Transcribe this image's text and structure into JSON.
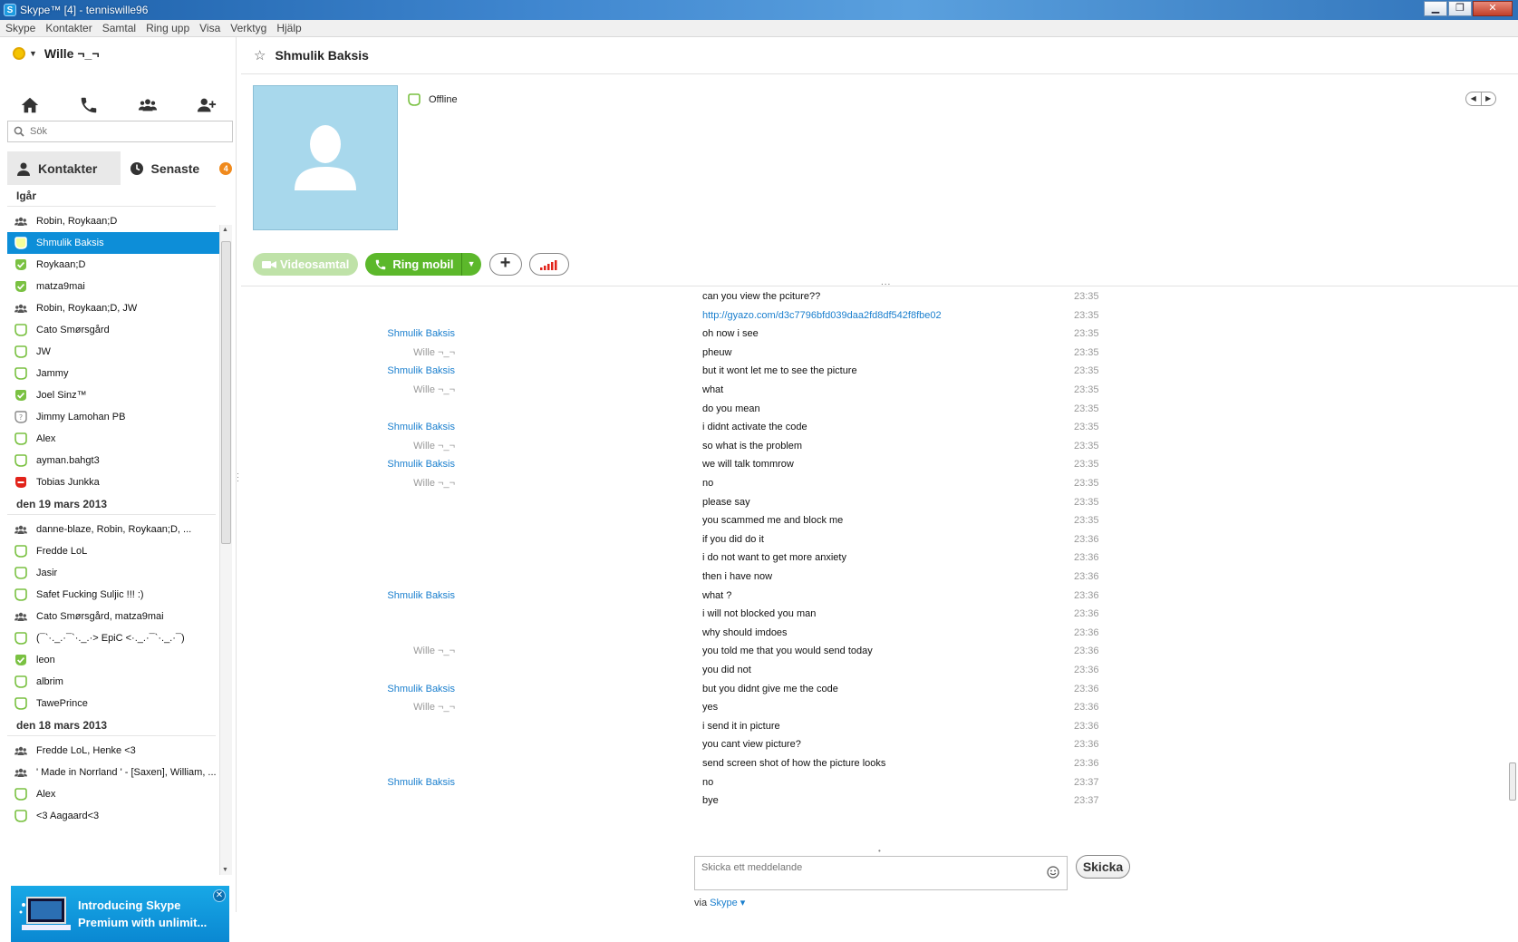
{
  "window": {
    "title": "Skype™ [4] - tenniswille96",
    "app_icon": "S",
    "minimize": "▁",
    "maximize": "❐",
    "close": "✕"
  },
  "menu": [
    "Skype",
    "Kontakter",
    "Samtal",
    "Ring upp",
    "Visa",
    "Verktyg",
    "Hjälp"
  ],
  "profile": {
    "name": "Wille ¬_¬",
    "status_color": "#f5c400"
  },
  "search": {
    "placeholder": "Sök"
  },
  "tabs": {
    "contacts": "Kontakter",
    "recent": "Senaste",
    "recent_badge": "4"
  },
  "contact_groups": [
    {
      "header": "Igår",
      "items": [
        {
          "name": "Robin, Roykaan;D",
          "icon": "group"
        },
        {
          "name": "Shmulik Baksis",
          "icon": "offline",
          "selected": true
        },
        {
          "name": "Roykaan;D",
          "icon": "online"
        },
        {
          "name": "matza9mai",
          "icon": "online"
        },
        {
          "name": "Robin, Roykaan;D, JW",
          "icon": "group"
        },
        {
          "name": "Cato Smørsgård",
          "icon": "offline"
        },
        {
          "name": "JW",
          "icon": "offline"
        },
        {
          "name": "Jammy",
          "icon": "offline"
        },
        {
          "name": "Joel Sinz™",
          "icon": "online"
        },
        {
          "name": "Jimmy Lamohan PB",
          "icon": "unknown"
        },
        {
          "name": "Alex",
          "icon": "offline"
        },
        {
          "name": "ayman.bahgt3",
          "icon": "offline"
        },
        {
          "name": "Tobias Junkka",
          "icon": "busy"
        }
      ]
    },
    {
      "header": "den 19 mars 2013",
      "items": [
        {
          "name": "danne-blaze, Robin, Roykaan;D, ...",
          "icon": "group"
        },
        {
          "name": "Fredde LoL",
          "icon": "offline"
        },
        {
          "name": "Jasir",
          "icon": "offline"
        },
        {
          "name": "Safet Fucking Suljic !!! :)",
          "icon": "offline"
        },
        {
          "name": "Cato Smørsgård, matza9mai",
          "icon": "group"
        },
        {
          "name": "(¯`·._.·¯`·._.·> EpiC <·._.·¯`·._.·¯)",
          "icon": "offline"
        },
        {
          "name": "leon",
          "icon": "online"
        },
        {
          "name": "albrim",
          "icon": "offline"
        },
        {
          "name": "TawePrince",
          "icon": "offline"
        }
      ]
    },
    {
      "header": "den 18 mars 2013",
      "items": [
        {
          "name": "Fredde LoL, Henke <3",
          "icon": "group"
        },
        {
          "name": "' Made in Norrland ' - [Saxen], William, ...",
          "icon": "group"
        },
        {
          "name": "Alex",
          "icon": "offline"
        },
        {
          "name": "<3 Aagaard<3",
          "icon": "offline"
        }
      ]
    }
  ],
  "promo": {
    "line1": "Introducing Skype",
    "line2": "Premium with unlimit..."
  },
  "conversation": {
    "name": "Shmulik Baksis",
    "presence": "Offline",
    "buttons": {
      "video": "Videosamtal",
      "mobile": "Ring mobil",
      "add": "+"
    },
    "messages": [
      {
        "author": "",
        "side": "",
        "text": "can you view the pciture??",
        "time": "23:35"
      },
      {
        "author": "",
        "side": "",
        "text": "http://gyazo.com/d3c7796bfd039daa2fd8df542f8fbe02",
        "time": "23:35",
        "link": true
      },
      {
        "author": "Shmulik Baksis",
        "side": "them",
        "text": "oh now i see",
        "time": "23:35"
      },
      {
        "author": "Wille ¬_¬",
        "side": "me",
        "text": "pheuw",
        "time": "23:35"
      },
      {
        "author": "Shmulik Baksis",
        "side": "them",
        "text": "but it wont let me to see the picture",
        "time": "23:35"
      },
      {
        "author": "Wille ¬_¬",
        "side": "me",
        "text": "what",
        "time": "23:35"
      },
      {
        "author": "",
        "side": "",
        "text": "do you mean",
        "time": "23:35"
      },
      {
        "author": "Shmulik Baksis",
        "side": "them",
        "text": "i didnt activate the code",
        "time": "23:35"
      },
      {
        "author": "Wille ¬_¬",
        "side": "me",
        "text": "so what is the problem",
        "time": "23:35"
      },
      {
        "author": "Shmulik Baksis",
        "side": "them",
        "text": "we will talk tommrow",
        "time": "23:35"
      },
      {
        "author": "Wille ¬_¬",
        "side": "me",
        "text": "no",
        "time": "23:35"
      },
      {
        "author": "",
        "side": "",
        "text": "please say",
        "time": "23:35"
      },
      {
        "author": "",
        "side": "",
        "text": "you scammed me and block me",
        "time": "23:35"
      },
      {
        "author": "",
        "side": "",
        "text": "if you did do it",
        "time": "23:36"
      },
      {
        "author": "",
        "side": "",
        "text": "i do not want to get more anxiety",
        "time": "23:36"
      },
      {
        "author": "",
        "side": "",
        "text": "then i have now",
        "time": "23:36"
      },
      {
        "author": "Shmulik Baksis",
        "side": "them",
        "text": "what ?",
        "time": "23:36"
      },
      {
        "author": "",
        "side": "",
        "text": "i will not blocked you man",
        "time": "23:36"
      },
      {
        "author": "",
        "side": "",
        "text": "why should imdoes",
        "time": "23:36"
      },
      {
        "author": "Wille ¬_¬",
        "side": "me",
        "text": "you told me that you would send today",
        "time": "23:36"
      },
      {
        "author": "",
        "side": "",
        "text": "you did not",
        "time": "23:36"
      },
      {
        "author": "Shmulik Baksis",
        "side": "them",
        "text": "but you didnt give me the code",
        "time": "23:36"
      },
      {
        "author": "Wille ¬_¬",
        "side": "me",
        "text": "yes",
        "time": "23:36"
      },
      {
        "author": "",
        "side": "",
        "text": "i send it in picture",
        "time": "23:36"
      },
      {
        "author": "",
        "side": "",
        "text": "you cant view picture?",
        "time": "23:36"
      },
      {
        "author": "",
        "side": "",
        "text": "send screen shot of how the picture looks",
        "time": "23:36"
      },
      {
        "author": "Shmulik Baksis",
        "side": "them",
        "text": "no",
        "time": "23:37"
      },
      {
        "author": "",
        "side": "",
        "text": "bye",
        "time": "23:37"
      }
    ],
    "composer_placeholder": "Skicka ett meddelande",
    "send_label": "Skicka",
    "via_prefix": "via",
    "via_link": "Skype"
  }
}
